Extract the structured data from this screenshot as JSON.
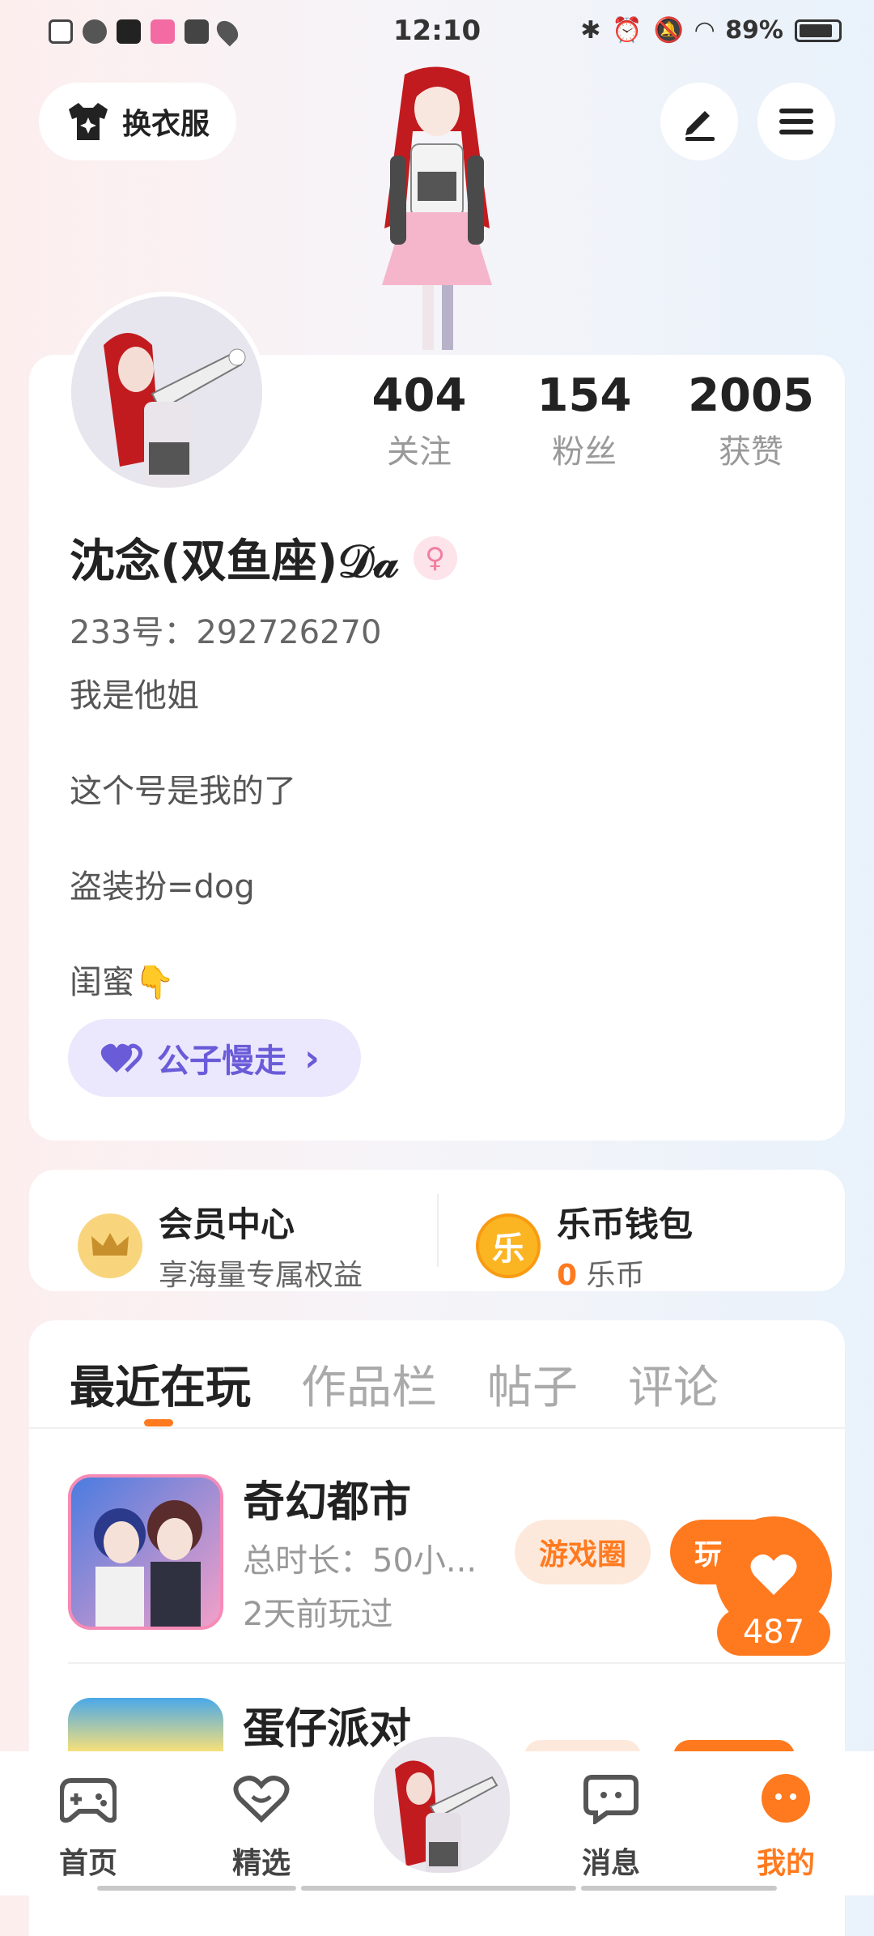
{
  "status_bar": {
    "time": "12:10",
    "battery": "89%",
    "icons": [
      "sim-icon",
      "app-icon",
      "tiktok-icon",
      "app-icon",
      "media-icon",
      "location-icon"
    ]
  },
  "header": {
    "outfit_button": "换衣服",
    "edit_icon": "pencil-icon",
    "menu_icon": "hamburger-icon"
  },
  "profile": {
    "stats": [
      {
        "value": "404",
        "label": "关注"
      },
      {
        "value": "154",
        "label": "粉丝"
      },
      {
        "value": "2005",
        "label": "获赞"
      }
    ],
    "name": "沈念(双鱼座)𝒟𝒶",
    "gender_symbol": "♀",
    "uid": "233号：292726270",
    "bio": [
      "我是他姐",
      "这个号是我的了",
      "盗装扮=dog",
      "闺蜜👇"
    ],
    "tag_label": "公子慢走",
    "tag_arrow": "›"
  },
  "services": {
    "member": {
      "title": "会员中心",
      "subtitle": "享海量专属权益",
      "icon": "crown-icon"
    },
    "wallet": {
      "title": "乐币钱包",
      "amount": "0",
      "unit": " 乐币",
      "icon_text": "乐"
    }
  },
  "tabs": [
    "最近在玩",
    "作品栏",
    "帖子",
    "评论"
  ],
  "games": [
    {
      "title": "奇幻都市",
      "duration": "总时长：50小...",
      "last_played": "2天前玩过",
      "circle_btn": "游戏圈",
      "play_btn": "玩"
    },
    {
      "title": "蛋仔派对",
      "duration": "",
      "last_played": "",
      "circle_btn": "",
      "play_btn": ""
    }
  ],
  "like": {
    "count": "487"
  },
  "bottom_nav": [
    {
      "label": "首页",
      "icon": "gamepad-icon"
    },
    {
      "label": "精选",
      "icon": "heart-chat-icon"
    },
    {
      "label": "消息",
      "icon": "message-icon"
    },
    {
      "label": "我的",
      "icon": "profile-face-icon"
    }
  ],
  "colors": {
    "accent": "#ff7a1f",
    "tag_bg": "#ebe8fd",
    "tag_text": "#6a5bd8"
  }
}
